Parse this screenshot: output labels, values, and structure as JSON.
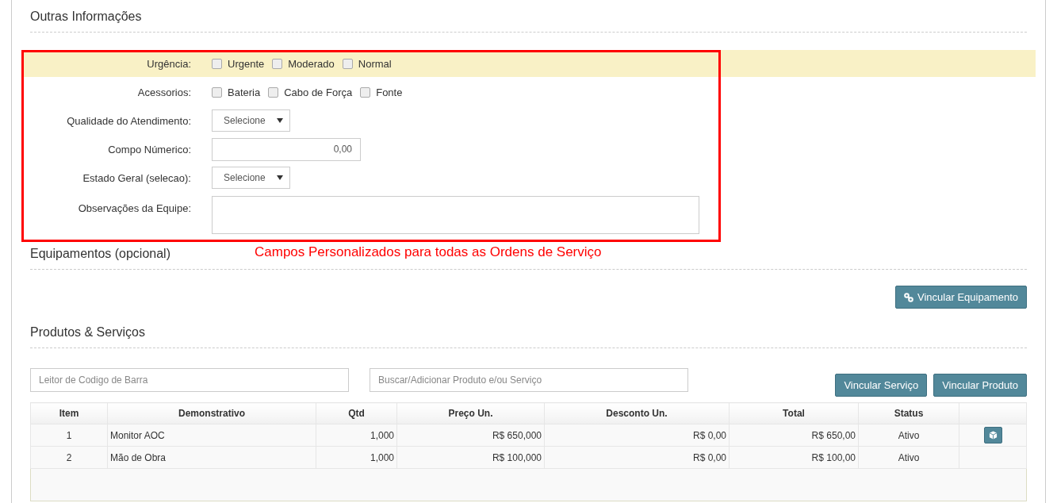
{
  "sections": [
    {
      "title": "Outras Informações"
    }
  ],
  "fields": [
    {
      "kind": "checkboxes",
      "label": "Urgência:",
      "highlighted": true,
      "options": [
        {
          "label": "Urgente",
          "checked": false
        },
        {
          "label": "Moderado",
          "checked": false
        },
        {
          "label": "Normal",
          "checked": false
        }
      ]
    },
    {
      "kind": "checkboxes",
      "label": "Acessorios:",
      "highlighted": false,
      "options": [
        {
          "label": "Bateria",
          "checked": false
        },
        {
          "label": "Cabo de Força",
          "checked": false
        },
        {
          "label": "Fonte",
          "checked": false
        }
      ]
    },
    {
      "kind": "select",
      "label": "Qualidade do Atendimento:",
      "value": "Selecione"
    },
    {
      "kind": "number",
      "label": "Compo Númerico:",
      "value": "0,00"
    },
    {
      "kind": "select",
      "label": "Estado Geral (selecao):",
      "value": "Selecione"
    },
    {
      "kind": "textarea",
      "label": "Observações da Equipe:"
    }
  ],
  "annotation": {
    "caption": "Campos Personalizados para todas as Ordens de Serviço"
  },
  "equipment": {
    "title": "Equipamentos (opcional)",
    "button": "Vincular Equipamento"
  },
  "products": {
    "title": "Produtos & Serviços",
    "barcode_placeholder": "Leitor de Codigo de Barra",
    "search_placeholder": "Buscar/Adicionar Produto e/ou Serviço",
    "buttons": [
      "Vincular Serviço",
      "Vincular Produto"
    ],
    "table": {
      "columns": [
        "Item",
        "Demonstrativo",
        "Qtd",
        "Preço Un.",
        "Desconto Un.",
        "Total",
        "Status"
      ],
      "rows": [
        {
          "cells": [
            "1",
            "Monitor AOC",
            "1,000",
            "R$ 650,000",
            "R$ 0,00",
            "R$ 650,00",
            "Ativo"
          ],
          "has_action": true
        },
        {
          "cells": [
            "2",
            "Mão de Obra",
            "1,000",
            "R$ 100,000",
            "R$ 0,00",
            "R$ 100,00",
            "Ativo"
          ],
          "has_action": false
        }
      ]
    }
  }
}
